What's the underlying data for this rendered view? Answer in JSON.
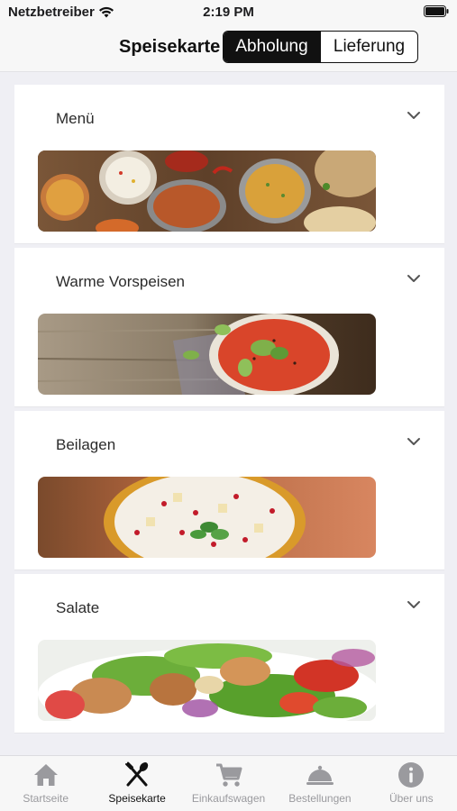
{
  "status_bar": {
    "carrier": "Netzbetreiber",
    "time": "2:19 PM"
  },
  "nav": {
    "title": "Speisekarte",
    "segments": [
      {
        "label": "Abholung",
        "selected": true
      },
      {
        "label": "Lieferung",
        "selected": false
      }
    ]
  },
  "categories": [
    {
      "title": "Menü",
      "image": "indian-dishes-spread",
      "expanded": false
    },
    {
      "title": "Warme Vorspeisen",
      "image": "tomato-soup-bowl",
      "expanded": false
    },
    {
      "title": "Beilagen",
      "image": "raita-pomegranate-bowl",
      "expanded": false
    },
    {
      "title": "Salate",
      "image": "chicken-salad",
      "expanded": false
    }
  ],
  "tabs": [
    {
      "label": "Startseite",
      "icon": "house-icon",
      "active": false
    },
    {
      "label": "Speisekarte",
      "icon": "fork-knife-icon",
      "active": true
    },
    {
      "label": "Einkaufswagen",
      "icon": "cart-icon",
      "active": false
    },
    {
      "label": "Bestellungen",
      "icon": "cloche-icon",
      "active": false
    },
    {
      "label": "Über uns",
      "icon": "info-icon",
      "active": false
    }
  ],
  "colors": {
    "accent": "#111111",
    "inactive_tab": "#9a9a9e",
    "background": "#efeff4"
  }
}
